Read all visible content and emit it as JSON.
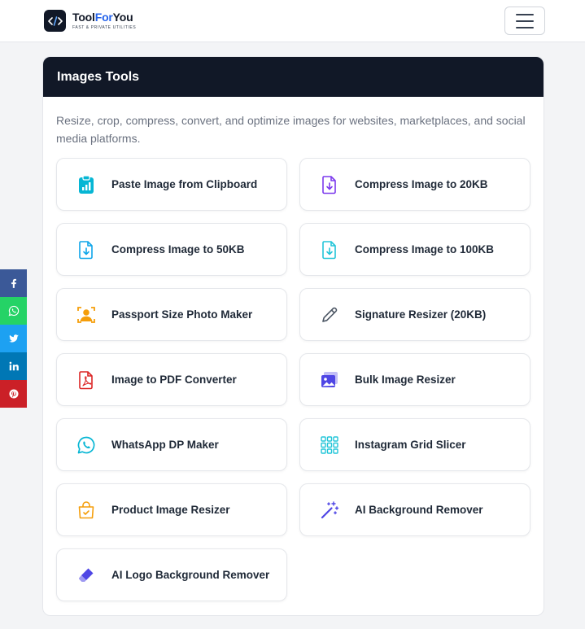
{
  "header": {
    "brand_part1": "Tool",
    "brand_part2": "For",
    "brand_part3": "You",
    "tagline": "FAST & PRIVATE UTILITIES",
    "menu_icon": "hamburger-icon"
  },
  "section": {
    "title": "Images Tools",
    "description": "Resize, crop, compress, convert, and optimize images for websites, marketplaces, and social media platforms."
  },
  "tools": [
    {
      "label": "Paste Image from Clipboard",
      "icon": "clipboard-chart-icon",
      "color": "#06b6d4"
    },
    {
      "label": "Compress Image to 20KB",
      "icon": "file-download-icon",
      "color": "#7c3aed"
    },
    {
      "label": "Compress Image to 50KB",
      "icon": "file-download-icon",
      "color": "#0ea5e9"
    },
    {
      "label": "Compress Image to 100KB",
      "icon": "file-download-icon",
      "color": "#22c5d8"
    },
    {
      "label": "Passport Size Photo Maker",
      "icon": "portrait-frame-icon",
      "color": "#f59e0b"
    },
    {
      "label": "Signature Resizer (20KB)",
      "icon": "pen-icon",
      "color": "#4b5563"
    },
    {
      "label": "Image to PDF Converter",
      "icon": "pdf-icon",
      "color": "#dc2626"
    },
    {
      "label": "Bulk Image Resizer",
      "icon": "images-icon",
      "color": "#4f46e5"
    },
    {
      "label": "WhatsApp DP Maker",
      "icon": "whatsapp-icon",
      "color": "#06b6d4"
    },
    {
      "label": "Instagram Grid Slicer",
      "icon": "grid-icon",
      "color": "#22c5d8"
    },
    {
      "label": "Product Image Resizer",
      "icon": "shopping-bag-icon",
      "color": "#f59e0b"
    },
    {
      "label": "AI Background Remover",
      "icon": "magic-wand-icon",
      "color": "#4f46e5"
    },
    {
      "label": "AI Logo Background Remover",
      "icon": "eraser-icon",
      "color": "#4f46e5"
    }
  ],
  "social": [
    {
      "name": "facebook-icon",
      "color": "#3b5998"
    },
    {
      "name": "whatsapp-icon",
      "color": "#25d366"
    },
    {
      "name": "twitter-icon",
      "color": "#1da1f2"
    },
    {
      "name": "linkedin-icon",
      "color": "#0077b5"
    },
    {
      "name": "pinterest-icon",
      "color": "#cb2027"
    }
  ]
}
